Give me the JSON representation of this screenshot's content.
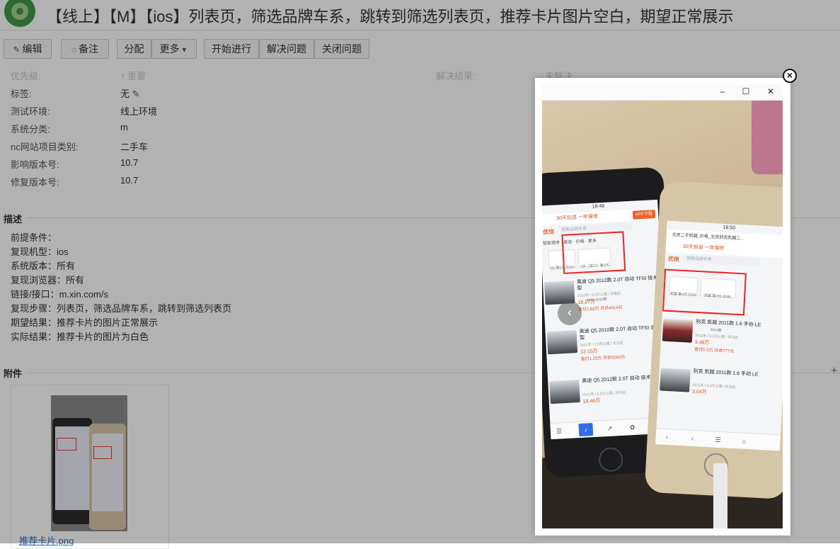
{
  "header": {
    "faint_text": "",
    "title": "【线上】【M】【ios】列表页，筛选品牌车系，跳转到筛选列表页，推荐卡片图片空白，期望正常展示"
  },
  "toolbar": {
    "edit": "编辑",
    "comment": "备注",
    "assign": "分配",
    "more": "更多",
    "start": "开始进行",
    "resolve": "解决问题",
    "close": "关闭问题"
  },
  "fields": [
    {
      "label": "优先级:",
      "value": "重要"
    },
    {
      "label": "标签:",
      "value": "无"
    },
    {
      "label": "测试环境:",
      "value": "线上环境"
    },
    {
      "label": "系统分类:",
      "value": "m"
    },
    {
      "label": "nc网站项目类别:",
      "value": "二手车"
    },
    {
      "label": "影响版本号:",
      "value": "10.7"
    },
    {
      "label": "修复版本号:",
      "value": "10.7"
    }
  ],
  "resolution": {
    "label": "解决结果:",
    "value": "未解决"
  },
  "description": {
    "title": "描述",
    "lines": [
      "前提条件：",
      "复现机型：ios",
      "系统版本：所有",
      "复现浏览器：所有",
      "链接/接口：m.xin.com/s",
      "复现步骤：列表页，筛选品牌车系，跳转到筛选列表页",
      "期望结果：推荐卡片的图片正常展示",
      "实际结果：推荐卡片的图片为白色"
    ]
  },
  "attachments": {
    "title": "附件",
    "file_name": "推荐卡片.png"
  },
  "viewer": {
    "window_controls": {
      "minimize": "–",
      "maximize": "☐",
      "close": "✕"
    },
    "close_glyph": "×",
    "prev_glyph": "‹",
    "phoneA": {
      "time": "18:49",
      "promo": "30天包退 一年保修",
      "app_button": "APP下载",
      "logo": "优信",
      "search_placeholder": "搜索品牌车系",
      "filters": "智能排序 · 奥迪 · 价格 · 更多",
      "cards": [
        "Q5 第1代 2010-2015款",
        "Q5（进口）第1代 2010-2015款"
      ],
      "listings": [
        {
          "title": "奥迪 Q5 2012款 2.0T 自动 TFSI 技术型",
          "meta": "2012年 / 8.0万公里 / 华南区",
          "price": "18.27万",
          "pay": "首付1.82万 月供4614元"
        },
        {
          "title": "奥迪 Q5 2010款 2.0T 自动 TFSI 进取型",
          "meta": "2010年 / 7.3万公里 / 东北区",
          "price": "13.15万",
          "pay": "首付1.29万 月供3263元"
        },
        {
          "title": "奥迪 Q5 2012款 2.0T 自动 技术型",
          "meta": "2012年 / 6.8万公里 / 华中区",
          "price": "18.46万",
          "pay": ""
        }
      ]
    },
    "phoneB": {
      "time": "18:50",
      "url": "北京二手凯越_价格_北京别克凯越二...",
      "promo": "30天包退 一年保修",
      "logo": "优信",
      "search_placeholder": "搜索品牌车系",
      "cards": [
        "凯越 第3代 2018款",
        "凯越 第2代 2008-2015款"
      ],
      "listings": [
        {
          "title": "别克 凯越 2011款 1.6 手动 LE",
          "meta": "2011年 / 9.2万公里 / 华北区",
          "price": "3.48万",
          "pay": "首付0.3万 月供777元"
        },
        {
          "title": "别克 凯越 2011款 1.6 手动 LE",
          "meta": "2011年 / 8.3万公里 / 华北区",
          "price": "3.04万",
          "pay": ""
        }
      ]
    }
  }
}
